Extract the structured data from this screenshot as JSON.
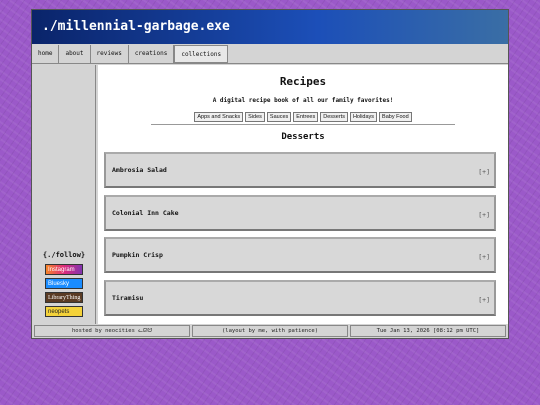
{
  "window": {
    "title": "./millennial-garbage.exe"
  },
  "nav": {
    "items": [
      {
        "label": "home"
      },
      {
        "label": "about"
      },
      {
        "label": "reviews"
      },
      {
        "label": "creations"
      },
      {
        "label": "collections"
      }
    ]
  },
  "sidebar": {
    "follow_title": "{./follow}",
    "badges": [
      {
        "label": "Instagram"
      },
      {
        "label": "Bluesky"
      },
      {
        "label": "LibraryThing"
      },
      {
        "label": "neopets"
      }
    ]
  },
  "main": {
    "title": "Recipes",
    "subtitle": "A digital recipe book of all our family favorites!",
    "tabs": [
      {
        "label": "Apps and Snacks"
      },
      {
        "label": "Sides"
      },
      {
        "label": "Sauces"
      },
      {
        "label": "Entrees"
      },
      {
        "label": "Desserts"
      },
      {
        "label": "Holidays"
      },
      {
        "label": "Baby Food"
      }
    ],
    "section_title": "Desserts",
    "recipes": [
      {
        "name": "Ambrosia Salad",
        "toggle": "[+]"
      },
      {
        "name": "Colonial Inn Cake",
        "toggle": "[+]"
      },
      {
        "name": "Pumpkin Crisp",
        "toggle": "[+]"
      },
      {
        "name": "Tiramisu",
        "toggle": "[+]"
      }
    ]
  },
  "footer": {
    "hosted": "hosted by neocities ᓚᘏᗢ",
    "layout": "(layout by me, with patience)",
    "datetime": "Tue Jan 13, 2026 [08:12 pm UTC]"
  },
  "colors": {
    "background": "#9b59c9",
    "titlebar": "#0a246a",
    "chrome": "#d4d4d4"
  }
}
